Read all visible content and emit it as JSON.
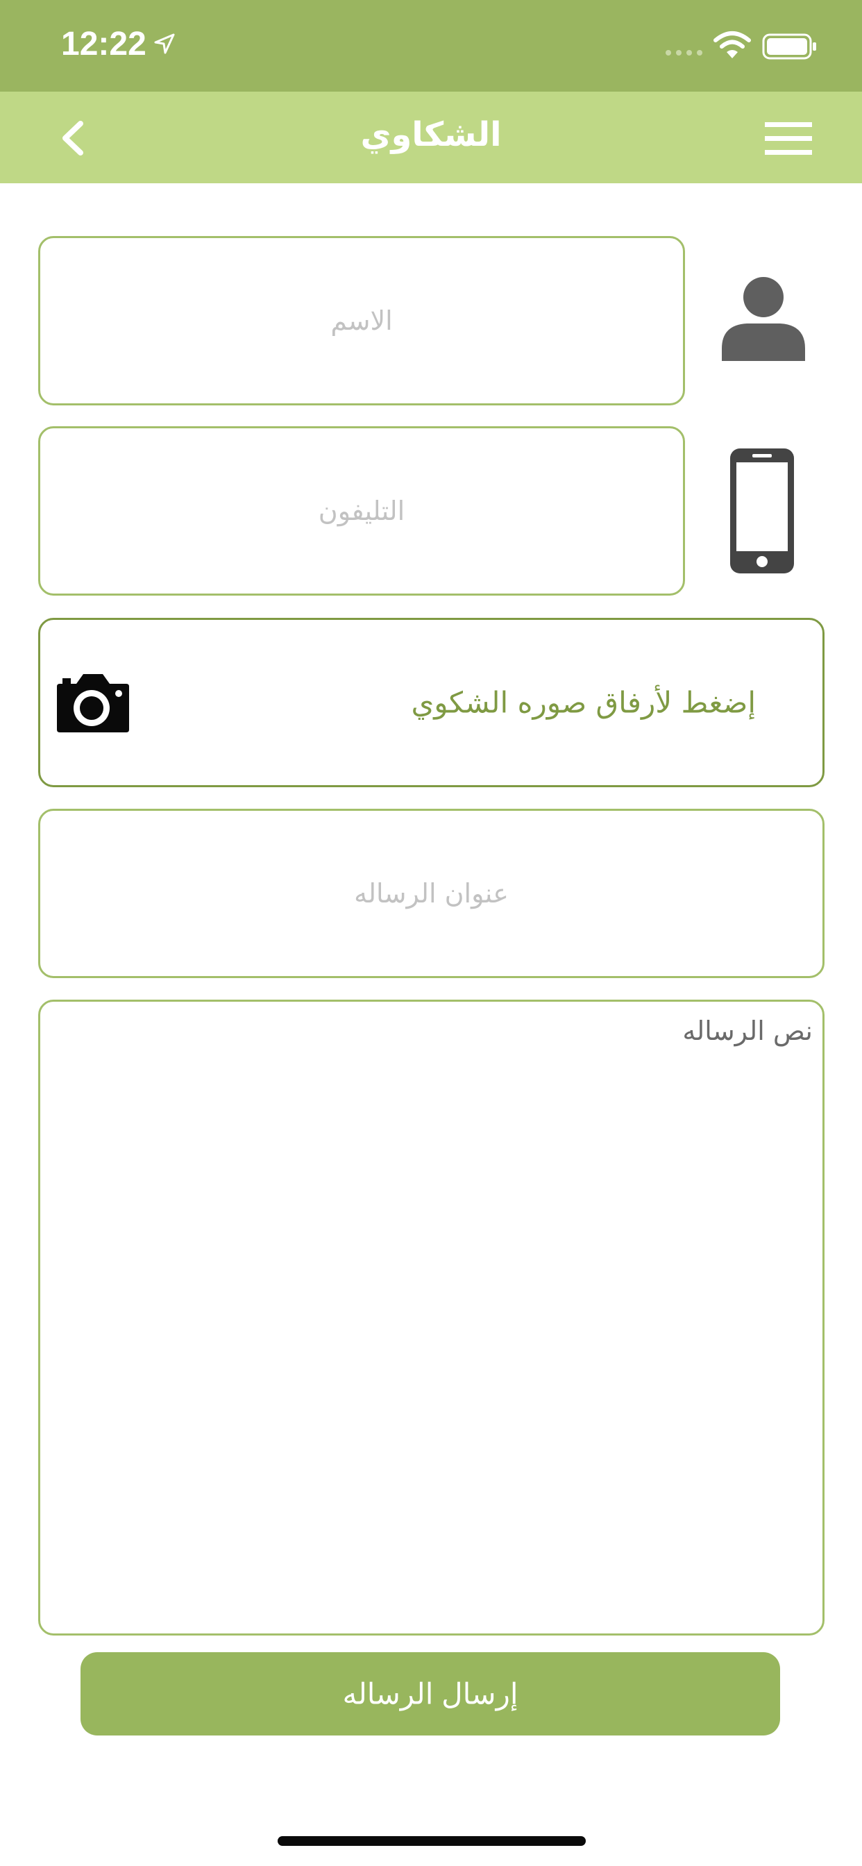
{
  "status_bar": {
    "time": "12:22",
    "icons": [
      "location-arrow-icon",
      "signal-icon",
      "wifi-icon",
      "battery-icon"
    ]
  },
  "nav_bar": {
    "title": "الشكاوي",
    "icons": [
      "back-chevron-icon",
      "hamburger-menu-icon"
    ]
  },
  "form": {
    "name_placeholder": "الاسم",
    "phone_placeholder": "التليفون",
    "attach_label": "إضغط لأرفاق صوره الشكوي",
    "subject_placeholder": "عنوان الرساله",
    "message_placeholder": "نص الرساله",
    "icons": [
      "person-icon",
      "smartphone-icon",
      "camera-icon"
    ]
  },
  "send_button": {
    "label": "إرسال الرساله"
  },
  "colors": {
    "status_bar": "#9ab560",
    "nav_bar": "#bfd886",
    "field_border": "#a3bf6a",
    "accent_text": "#7f9a43",
    "button": "#98b65d"
  }
}
